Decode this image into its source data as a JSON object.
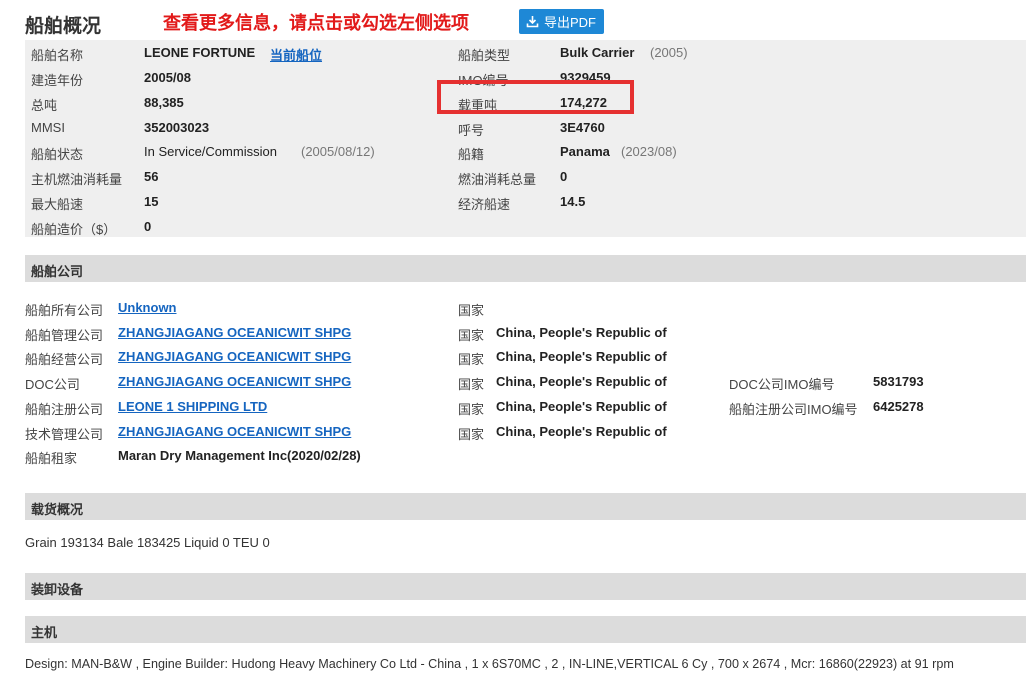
{
  "header": {
    "title": "船舶概况",
    "notice": "查看更多信息，请点击或勾选左侧选项",
    "pdf_button": "导出PDF"
  },
  "overview": {
    "ship_name_label": "船舶名称",
    "ship_name": "LEONE FORTUNE",
    "current_position_link": "当前船位",
    "ship_type_label": "船舶类型",
    "ship_type": "Bulk Carrier",
    "ship_type_year": "(2005)",
    "built_label": "建造年份",
    "built": "2005/08",
    "imo_label": "IMO编号",
    "imo": "9329459",
    "gt_label": "总吨",
    "gt": "88,385",
    "dwt_label": "载重吨",
    "dwt": "174,272",
    "mmsi_label": "MMSI",
    "mmsi": "352003023",
    "callsign_label": "呼号",
    "callsign": "3E4760",
    "status_label": "船舶状态",
    "status": "In Service/Commission",
    "status_date": "(2005/08/12)",
    "flag_label": "船籍",
    "flag": "Panama",
    "flag_date": "(2023/08)",
    "me_fuel_label": "主机燃油消耗量",
    "me_fuel": "56",
    "total_fuel_label": "燃油消耗总量",
    "total_fuel": "0",
    "max_speed_label": "最大船速",
    "max_speed": "15",
    "eco_speed_label": "经济船速",
    "eco_speed": "14.5",
    "price_label": "船舶造价（$）",
    "price": "0"
  },
  "company": {
    "section_title": "船舶公司",
    "country_label": "国家",
    "rows": [
      {
        "label": "船舶所有公司",
        "name": "Unknown",
        "country": ""
      },
      {
        "label": "船舶管理公司",
        "name": "ZHANGJIAGANG OCEANICWIT SHPG",
        "country": "China, People's Republic of"
      },
      {
        "label": "船舶经营公司",
        "name": "ZHANGJIAGANG OCEANICWIT SHPG",
        "country": "China, People's Republic of"
      },
      {
        "label": "DOC公司",
        "name": "ZHANGJIAGANG OCEANICWIT SHPG",
        "country": "China, People's Republic of",
        "imo_label": "DOC公司IMO编号",
        "imo": "5831793"
      },
      {
        "label": "船舶注册公司",
        "name": "LEONE 1 SHIPPING LTD",
        "country": "China, People's Republic of",
        "imo_label": "船舶注册公司IMO编号",
        "imo": "6425278"
      },
      {
        "label": "技术管理公司",
        "name": "ZHANGJIAGANG OCEANICWIT SHPG",
        "country": "China, People's Republic of"
      }
    ],
    "charterer_label": "船舶租家",
    "charterer": "Maran Dry Management Inc(2020/02/28)"
  },
  "cargo": {
    "section_title": "载货概况",
    "text": "Grain 193134 Bale 183425 Liquid 0 TEU 0"
  },
  "equipment": {
    "section_title": "装卸设备"
  },
  "main_engine": {
    "section_title": "主机",
    "text": "Design: MAN-B&W , Engine Builder: Hudong Heavy Machinery Co Ltd - China , 1 x 6S70MC , 2 , IN-LINE,VERTICAL 6 Cy , 700 x 2674 , Mcr: 16860(22923) at 91 rpm"
  }
}
